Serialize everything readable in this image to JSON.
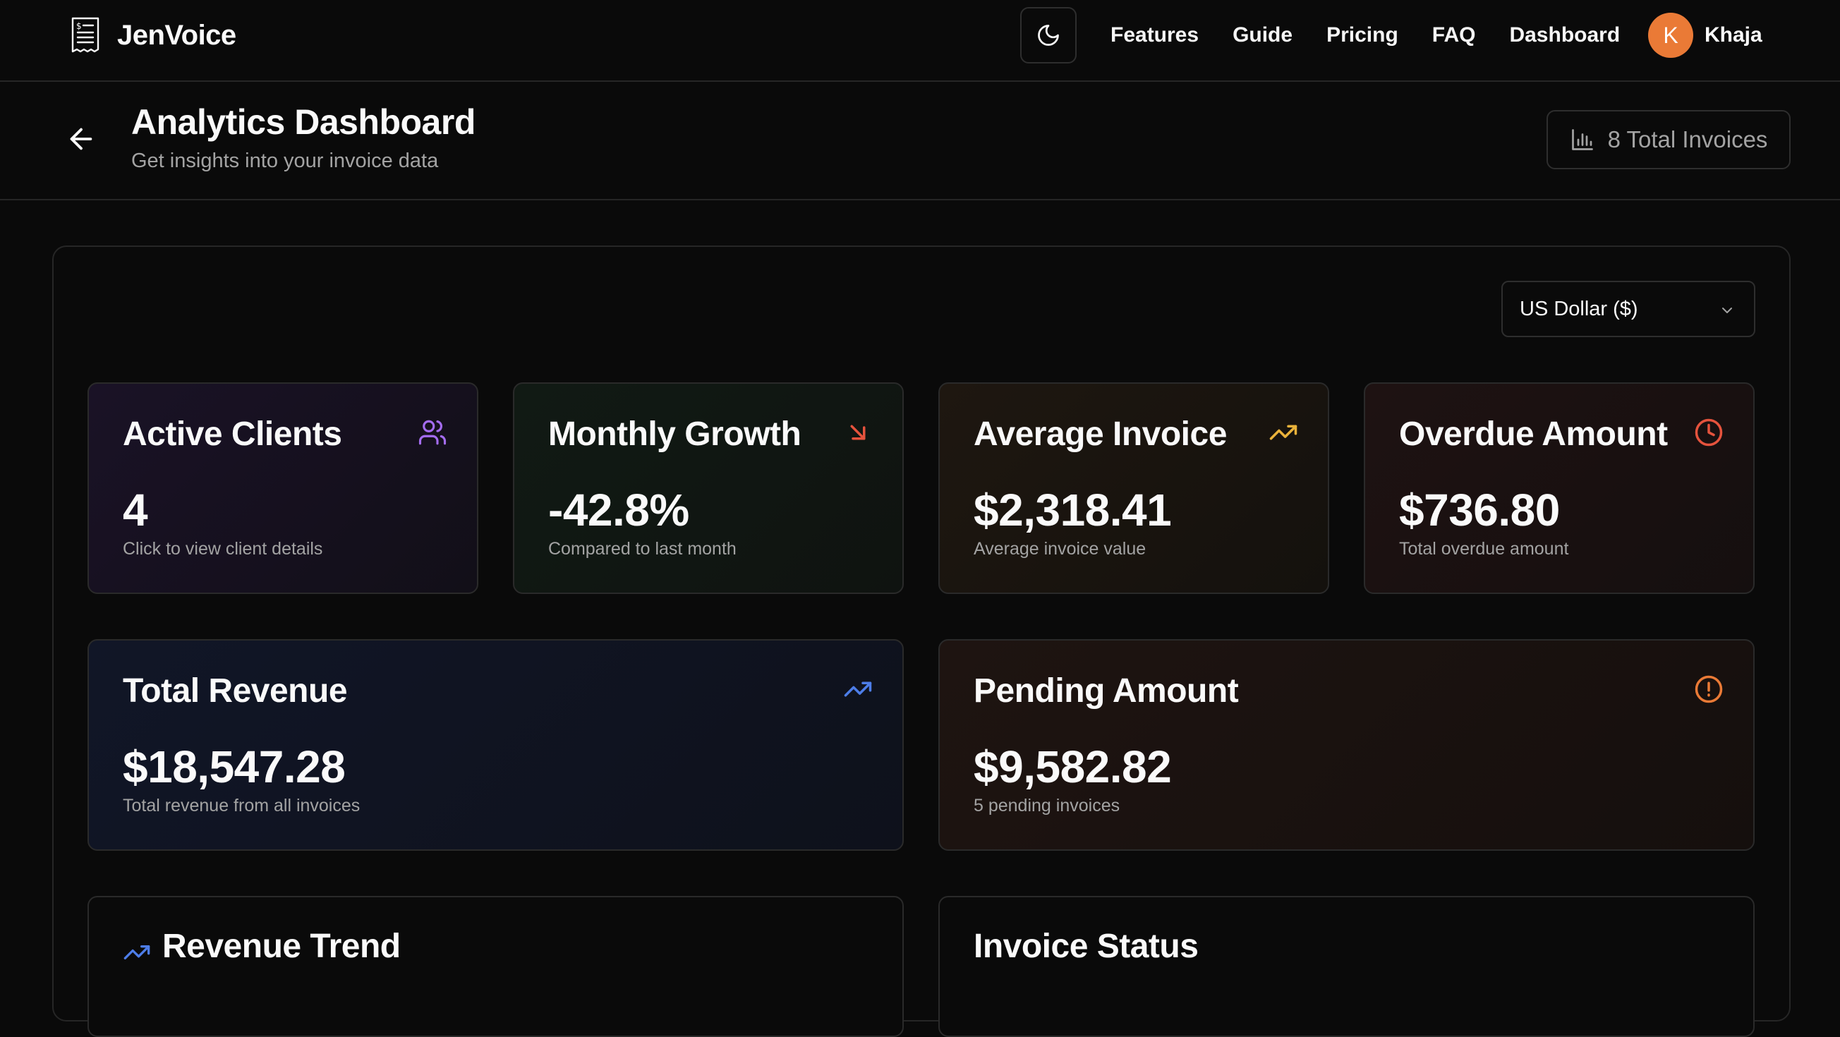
{
  "nav": {
    "brand": "JenVoice",
    "links": [
      "Features",
      "Guide",
      "Pricing",
      "FAQ",
      "Dashboard"
    ],
    "user": {
      "initial": "K",
      "name": "Khaja"
    },
    "icons": {
      "logo": "receipt-icon",
      "theme": "moon-icon"
    }
  },
  "header": {
    "title": "Analytics Dashboard",
    "subtitle": "Get insights into your invoice data",
    "total_badge": "8 Total Invoices"
  },
  "currency_select": {
    "value": "US Dollar ($)"
  },
  "cards": {
    "active_clients": {
      "title": "Active Clients",
      "value": "4",
      "sub": "Click to view client details",
      "icon": "users-icon",
      "color": "#a46cf0"
    },
    "monthly_growth": {
      "title": "Monthly Growth",
      "value": "-42.8%",
      "sub": "Compared to last month",
      "icon": "arrow-down-right-icon",
      "color": "#e5533d"
    },
    "average_invoice": {
      "title": "Average Invoice",
      "value": "$2,318.41",
      "sub": "Average invoice value",
      "icon": "trending-up-icon",
      "color": "#eab23a"
    },
    "overdue_amount": {
      "title": "Overdue Amount",
      "value": "$736.80",
      "sub": "Total overdue amount",
      "icon": "clock-icon",
      "color": "#e5533d"
    },
    "total_revenue": {
      "title": "Total Revenue",
      "value": "$18,547.28",
      "sub": "Total revenue from all invoices",
      "icon": "trending-up-icon",
      "color": "#4d7de8"
    },
    "pending_amount": {
      "title": "Pending Amount",
      "value": "$9,582.82",
      "sub": "5 pending invoices",
      "icon": "alert-circle-icon",
      "color": "#ea7a36"
    }
  },
  "sections": {
    "revenue_trend": {
      "title": "Revenue Trend",
      "icon": "trending-up-icon",
      "color": "#4d7de8"
    },
    "invoice_status": {
      "title": "Invoice Status"
    }
  }
}
